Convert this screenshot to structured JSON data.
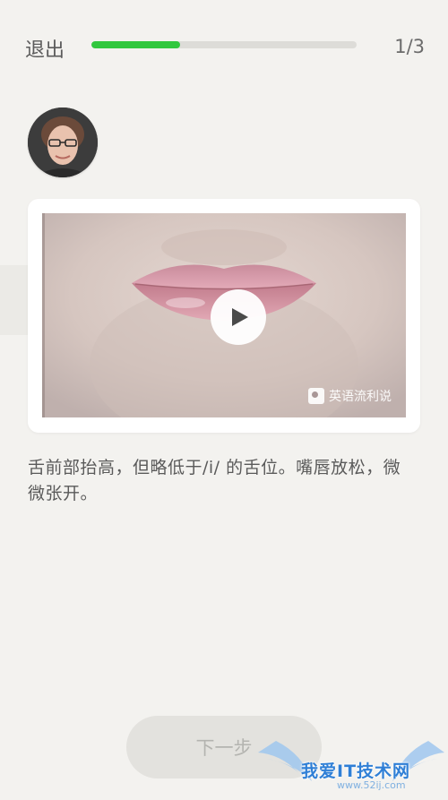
{
  "header": {
    "exit_label": "退出",
    "progress_fraction": 0.335,
    "counter": "1/3",
    "accent_color": "#32c73e"
  },
  "avatar": {
    "icon": "teacher-avatar"
  },
  "video": {
    "brand_label": "英语流利说",
    "play_icon": "play-icon"
  },
  "lesson": {
    "description": "舌前部抬高，但略低于/i/ 的舌位。嘴唇放松，微微张开。"
  },
  "footer": {
    "next_label": "下一步"
  },
  "watermark": {
    "site_name": "我爱IT技术网",
    "site_url": "www.52ij.com"
  }
}
